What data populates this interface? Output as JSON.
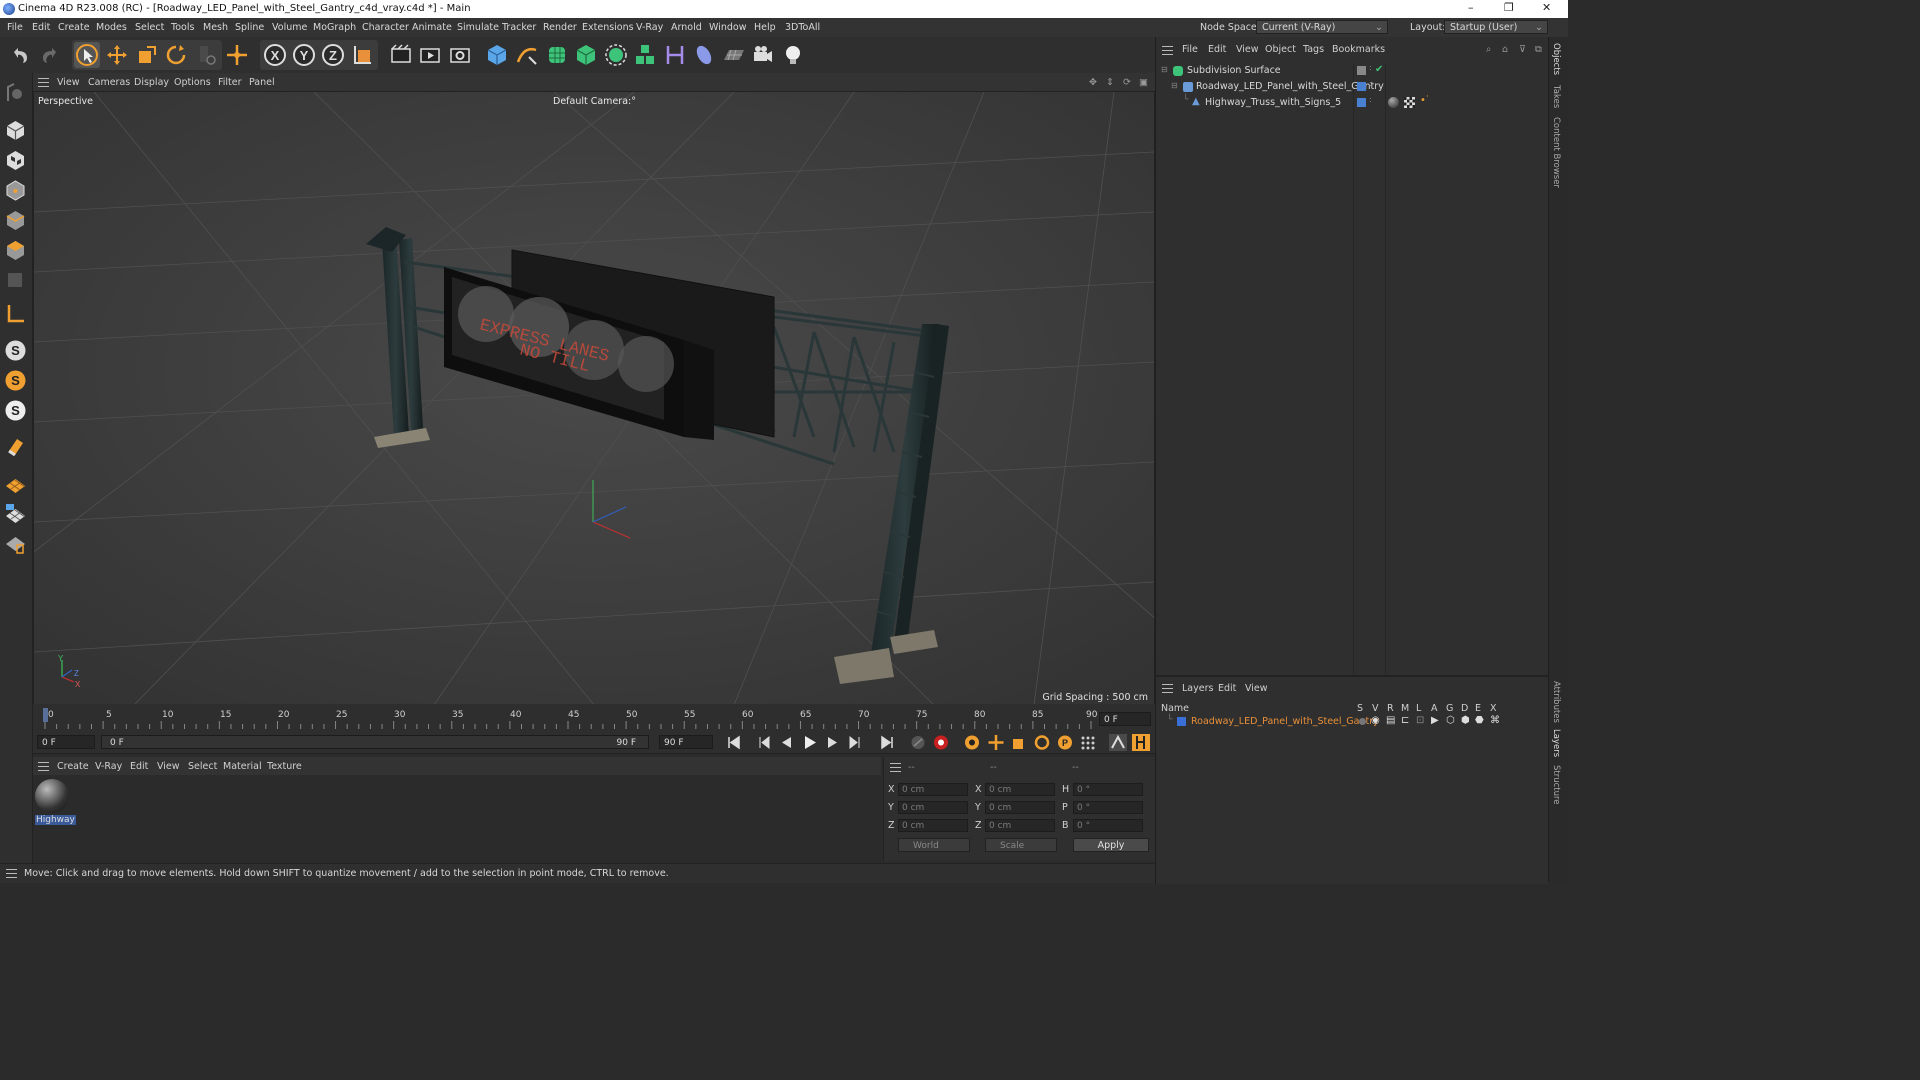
{
  "window": {
    "title": "Cinema 4D R23.008 (RC) - [Roadway_LED_Panel_with_Steel_Gantry_c4d_vray.c4d *] - Main",
    "controls": {
      "minimize": "–",
      "maximize": "❐",
      "close": "✕"
    }
  },
  "menubar": {
    "items": [
      "File",
      "Edit",
      "Create",
      "Modes",
      "Select",
      "Tools",
      "Mesh",
      "Spline",
      "Volume",
      "MoGraph",
      "Character",
      "Animate",
      "Simulate",
      "Tracker",
      "Render",
      "Extensions",
      "V-Ray",
      "Arnold",
      "Window",
      "Help",
      "3DToAll"
    ],
    "node_space_label": "Node Space:",
    "node_space_value": "Current (V-Ray)",
    "layout_label": "Layout:",
    "layout_value": "Startup (User)"
  },
  "viewport": {
    "menu": [
      "View",
      "Cameras",
      "Display",
      "Options",
      "Filter",
      "Panel"
    ],
    "view_name": "Perspective",
    "camera": "Default Camera",
    "camera_suffix": ":°",
    "grid_spacing": "Grid Spacing : 500 cm",
    "sign_text_line1": "EXPRESS LANES",
    "sign_text_line2": "NO TILL",
    "axis_labels": {
      "y": "Y",
      "z": "Z",
      "x": "X"
    }
  },
  "timeline": {
    "ticks": [
      "0",
      "5",
      "10",
      "15",
      "20",
      "25",
      "30",
      "35",
      "40",
      "45",
      "50",
      "55",
      "60",
      "65",
      "70",
      "75",
      "80",
      "85",
      "90"
    ],
    "current_frame": "0 F",
    "start_field": "0 F",
    "range_start": "0 F",
    "range_end": "90 F",
    "end_field": "90 F"
  },
  "materials": {
    "menu": [
      "Create",
      "V-Ray",
      "Edit",
      "View",
      "Select",
      "Material",
      "Texture"
    ],
    "items": [
      {
        "label": "Highway"
      }
    ]
  },
  "coords": {
    "headers": [
      "--",
      "--",
      "--"
    ],
    "rows": [
      {
        "a_label": "X",
        "a_val": "0 cm",
        "b_label": "X",
        "b_val": "0 cm",
        "c_label": "H",
        "c_val": "0 °"
      },
      {
        "a_label": "Y",
        "a_val": "0 cm",
        "b_label": "Y",
        "b_val": "0 cm",
        "c_label": "P",
        "c_val": "0 °"
      },
      {
        "a_label": "Z",
        "a_val": "0 cm",
        "b_label": "Z",
        "b_val": "0 cm",
        "c_label": "B",
        "c_val": "0 °"
      }
    ],
    "world_select": "World",
    "scale_select": "Scale",
    "apply_label": "Apply"
  },
  "status": {
    "text": "Move: Click and drag to move elements. Hold down SHIFT to quantize movement / add to the selection in point mode, CTRL to remove."
  },
  "objects": {
    "menu": [
      "File",
      "Edit",
      "View",
      "Object",
      "Tags",
      "Bookmarks"
    ],
    "items": [
      {
        "name": "Subdivision Surface"
      },
      {
        "name": "Roadway_LED_Panel_with_Steel_Gantry"
      },
      {
        "name": "Highway_Truss_with_Signs_5"
      }
    ]
  },
  "layers": {
    "menu": [
      "Layers",
      "Edit",
      "View"
    ],
    "name_header": "Name",
    "columns": [
      "S",
      "V",
      "R",
      "M",
      "L",
      "A",
      "G",
      "D",
      "E",
      "X"
    ],
    "items": [
      {
        "name": "Roadway_LED_Panel_with_Steel_Gantry",
        "color": "#3a6fd8"
      }
    ]
  },
  "side_tabs": [
    "Objects",
    "Takes",
    "Content Browser",
    "Attributes",
    "Layers",
    "Structure"
  ],
  "colors": {
    "accent": "#f0a030",
    "selection_blue": "#4a80d0",
    "layer_orange": "#e8903a"
  }
}
